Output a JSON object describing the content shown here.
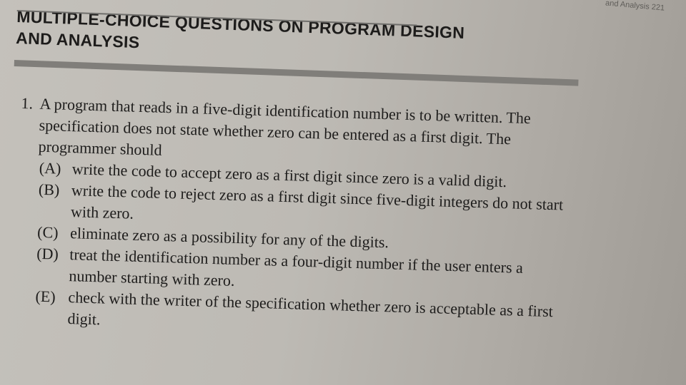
{
  "running_head": "and Analysis  221",
  "section": {
    "title_line1": "MULTIPLE-CHOICE QUESTIONS ON PROGRAM DESIGN",
    "title_line2": "AND ANALYSIS"
  },
  "question": {
    "number": "1.",
    "stem": "A program that reads in a five-digit identification number is to be written. The specification does not state whether zero can be entered as a first digit. The programmer should",
    "choices": [
      {
        "letter": "(A)",
        "text": "write the code to accept zero as a first digit since zero is a valid digit."
      },
      {
        "letter": "(B)",
        "text": "write the code to reject zero as a first digit since five-digit integers do not start with zero."
      },
      {
        "letter": "(C)",
        "text": "eliminate zero as a possibility for any of the digits."
      },
      {
        "letter": "(D)",
        "text": "treat the identification number as a four-digit number if the user enters a number starting with zero."
      },
      {
        "letter": "(E)",
        "text": "check with the writer of the specification whether zero is acceptable as a first digit."
      }
    ]
  }
}
